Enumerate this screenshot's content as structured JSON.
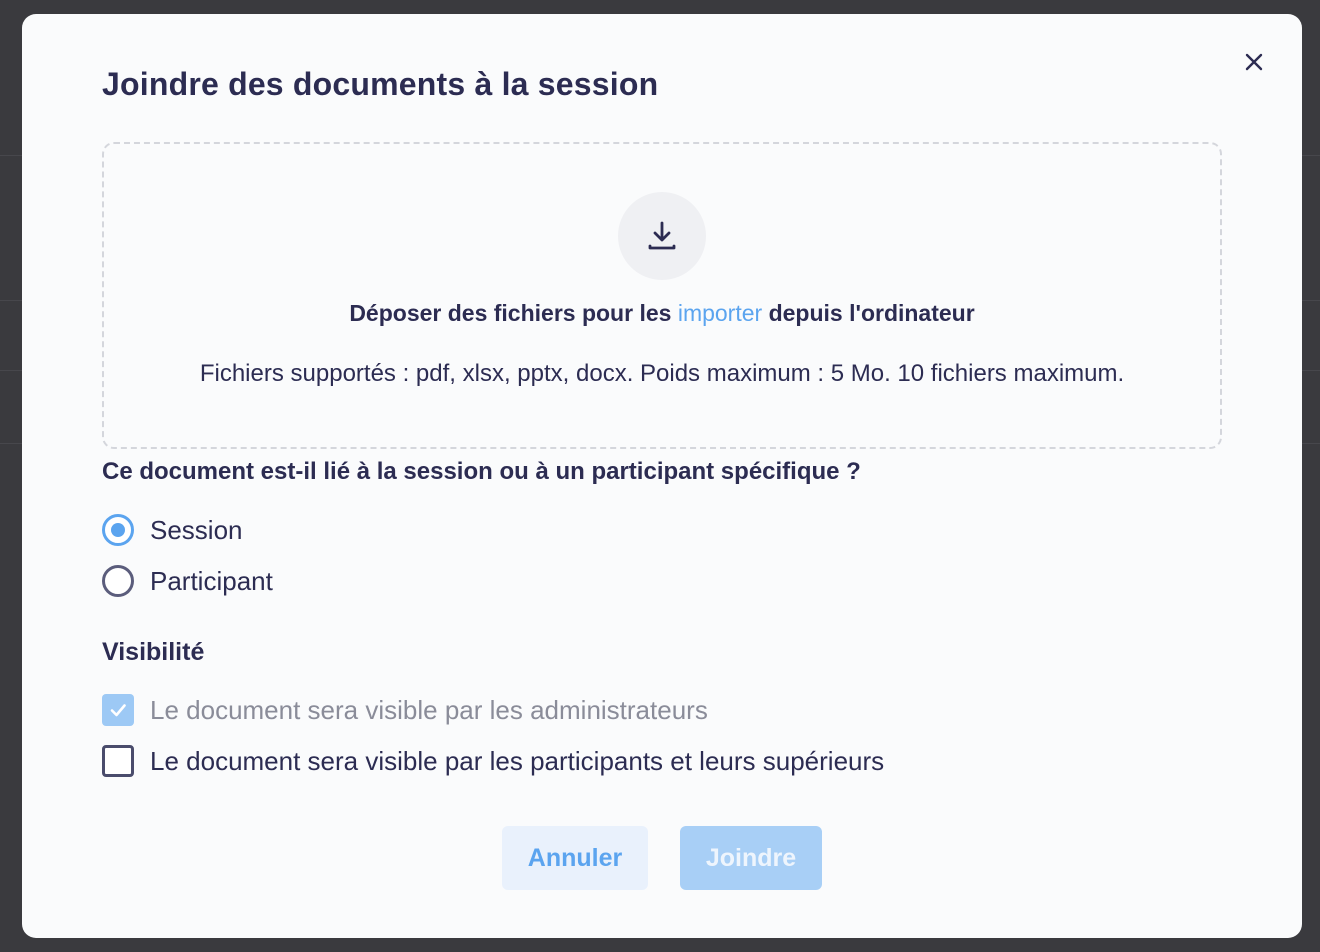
{
  "modal": {
    "title": "Joindre des documents à la session",
    "close_icon": "close-icon"
  },
  "dropzone": {
    "icon": "download-icon",
    "text_before": "Déposer des fichiers pour les ",
    "link_text": "importer",
    "text_after": " depuis l'ordinateur",
    "supported": "Fichiers supportés : pdf, xlsx, pptx, docx. Poids maximum : 5 Mo. 10 fichiers maximum."
  },
  "linkage": {
    "question": "Ce document est-il lié à la session ou à un participant spécifique ?",
    "options": [
      {
        "label": "Session",
        "selected": true
      },
      {
        "label": "Participant",
        "selected": false
      }
    ]
  },
  "visibility": {
    "title": "Visibilité",
    "options": [
      {
        "label": "Le document sera visible par les administrateurs",
        "checked": true,
        "disabled": true
      },
      {
        "label": "Le document sera visible par les participants et leurs supérieurs",
        "checked": false,
        "disabled": false
      }
    ]
  },
  "buttons": {
    "cancel_label": "Annuler",
    "join_label": "Joindre"
  },
  "colors": {
    "accent": "#5ba4ef",
    "text": "#2c2c52",
    "disabled_button": "#a8cff6",
    "overlay": "#3a3a3e"
  }
}
